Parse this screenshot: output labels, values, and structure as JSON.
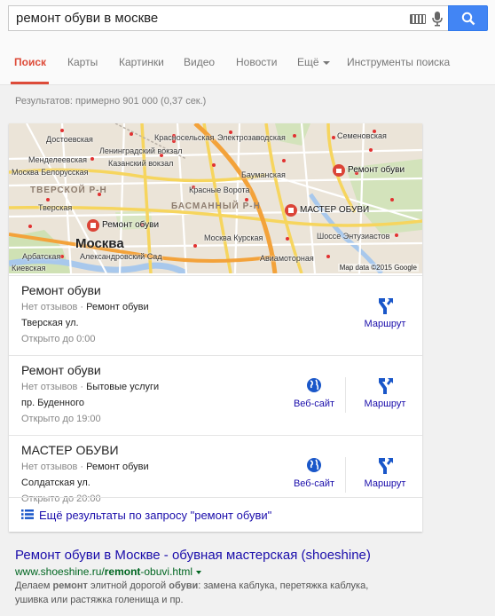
{
  "search": {
    "query": "ремонт обуви в москве"
  },
  "tabs": [
    {
      "label": "Поиск",
      "active": true
    },
    {
      "label": "Карты"
    },
    {
      "label": "Картинки"
    },
    {
      "label": "Видео"
    },
    {
      "label": "Новости"
    },
    {
      "label": "Ещё"
    },
    {
      "label": "Инструменты поиска"
    }
  ],
  "results_count": "Результатов: примерно 901 000 (0,37 сек.)",
  "map": {
    "labels": {
      "dostoevskaya": "Достоевская",
      "krasnoselskaya": "Красносельская",
      "elektrozavodskaya": "Электрозаводская",
      "semenovskaya": "Семеновская",
      "leningradsky": "Ленинградский вокзал",
      "mendeleevskaya": "Менделеевская",
      "kazansky": "Казанский вокзал",
      "belorusskaya": "Москва Белорусская",
      "baumanskaya": "Бауманская",
      "krasnye_vorota": "Красные Ворота",
      "tverskaya": "Тверская",
      "kurskaya": "Москва Курская",
      "shosse_entuziastov": "Шоссе Энтузиастов",
      "arbatskaya": "Арбатская",
      "aleksandrovsky": "Александровский Сад",
      "aviamotornaya": "Авиамоторная",
      "kievskaya": "Киевская"
    },
    "districts": {
      "tverskoy": "ТВЕРСКОЙ Р-Н",
      "basmanny": "БАСМАННЫЙ Р-Н"
    },
    "city": "Москва",
    "pins": {
      "pin1": "Ремонт обуви",
      "pin2": "Ремонт обуви",
      "pin3": "МАСТЕР ОБУВИ"
    },
    "attribution": "Map data ©2015 Google"
  },
  "listings": [
    {
      "title": "Ремонт обуви",
      "reviews": "Нет отзывов",
      "category": "Ремонт обуви",
      "address": "Тверская ул.",
      "hours": "Открыто до 0:00",
      "website": null,
      "route": "Маршрут"
    },
    {
      "title": "Ремонт обуви",
      "reviews": "Нет отзывов",
      "category": "Бытовые услуги",
      "address": "пр. Буденного",
      "hours": "Открыто до 19:00",
      "website": "Веб-сайт",
      "route": "Маршрут"
    },
    {
      "title": "МАСТЕР ОБУВИ",
      "reviews": "Нет отзывов",
      "category": "Ремонт обуви",
      "address": "Солдатская ул.",
      "hours": "Открыто до 20:00",
      "website": "Веб-сайт",
      "route": "Маршрут"
    }
  ],
  "more_results": "Ещё результаты по запросу \"ремонт обуви\"",
  "result": {
    "title": "Ремонт обуви в Москве - обувная мастерская (shoeshine)",
    "url_prefix": "www.shoeshine.ru/",
    "url_bold": "remont",
    "url_suffix": "-obuvi.html",
    "snippet_1": "Делаем ",
    "snippet_b1": "ремонт",
    "snippet_2": " элитной дорогой ",
    "snippet_b2": "обуви",
    "snippet_3": ": замена каблука, перетяжка каблука, ушивка или растяжка голенища и пр."
  },
  "colors": {
    "accent": "#dd4b39",
    "link": "#1a0dab",
    "url": "#006621",
    "button": "#4285f4"
  }
}
